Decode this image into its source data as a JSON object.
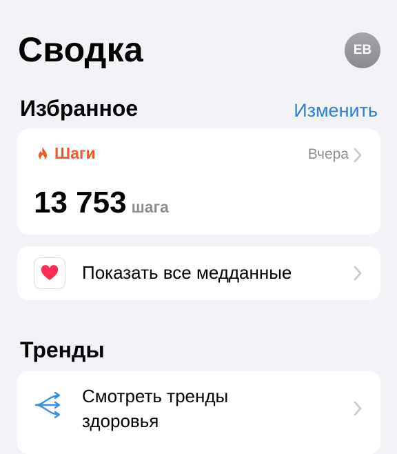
{
  "header": {
    "title": "Сводка",
    "avatar_initials": "EB"
  },
  "favorites": {
    "section_title": "Избранное",
    "edit_label": "Изменить",
    "steps_card": {
      "icon": "flame-icon",
      "label": "Шаги",
      "date": "Вчера",
      "value": "13 753",
      "unit": "шага",
      "accent_color": "#ea5a2a"
    },
    "show_all": {
      "icon": "heart-icon",
      "label": "Показать все медданные"
    }
  },
  "trends": {
    "section_title": "Тренды",
    "view_trends": {
      "icon": "trends-arrows-icon",
      "label_line1": "Смотреть тренды",
      "label_line2": "здоровья"
    }
  },
  "colors": {
    "background": "#f2f2f7",
    "link": "#2c7ed6",
    "heart": "#ff2d55",
    "trend_icon": "#3a8fe0"
  }
}
